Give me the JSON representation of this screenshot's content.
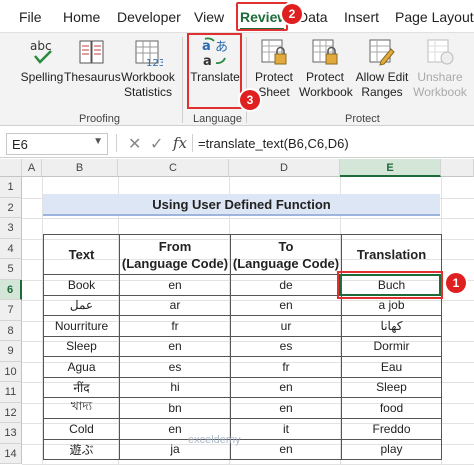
{
  "ribbon_tabs": [
    "File",
    "Home",
    "Developer",
    "View",
    "Review",
    "Data",
    "Insert",
    "Page Layout"
  ],
  "active_tab": "Review",
  "proofing": {
    "spelling": "Spelling",
    "thesaurus": "Thesaurus",
    "workbook_statistics_1": "Workbook",
    "workbook_statistics_2": "Statistics",
    "group": "Proofing"
  },
  "language": {
    "translate": "Translate",
    "group": "Language"
  },
  "protect": {
    "protect_sheet_1": "Protect",
    "protect_sheet_2": "Sheet",
    "protect_workbook_1": "Protect",
    "protect_workbook_2": "Workbook",
    "allow_edit_1": "Allow Edit",
    "allow_edit_2": "Ranges",
    "unshare_1": "Unshare",
    "unshare_2": "Workbook",
    "group": "Protect"
  },
  "badges": {
    "b1": "1",
    "b2": "2",
    "b3": "3"
  },
  "formula_bar": {
    "name_box": "E6",
    "cancel": "✕",
    "enter": "✓",
    "fx": "fx",
    "formula": "=translate_text(B6,C6,D6)"
  },
  "columns": [
    "A",
    "B",
    "C",
    "D",
    "E"
  ],
  "rows": [
    "1",
    "2",
    "3",
    "4",
    "5",
    "6",
    "7",
    "8",
    "9",
    "10",
    "11",
    "12",
    "13",
    "14"
  ],
  "sheet_title": "Using User Defined Function",
  "table": {
    "headers": {
      "text": "Text",
      "from_1": "From",
      "from_2": "(Language Code)",
      "to_1": "To",
      "to_2": "(Language Code)",
      "translation": "Translation"
    },
    "rows": [
      [
        "Book",
        "en",
        "de",
        "Buch"
      ],
      [
        "عمل",
        "ar",
        "en",
        "a job"
      ],
      [
        "Nourriture",
        "fr",
        "ur",
        "کھانا"
      ],
      [
        "Sleep",
        "en",
        "es",
        "Dormir"
      ],
      [
        "Agua",
        "es",
        "fr",
        "Eau"
      ],
      [
        "नींद",
        "hi",
        "en",
        "Sleep"
      ],
      [
        "খাদ্য",
        "bn",
        "en",
        "food"
      ],
      [
        "Cold",
        "en",
        "it",
        "Freddo"
      ],
      [
        "遊ぶ",
        "ja",
        "en",
        "play"
      ]
    ]
  },
  "watermark": "exceldemy",
  "colors": {
    "accent": "#1e6b3a",
    "highlight": "#e03030",
    "title_fill": "#dce6f4"
  }
}
